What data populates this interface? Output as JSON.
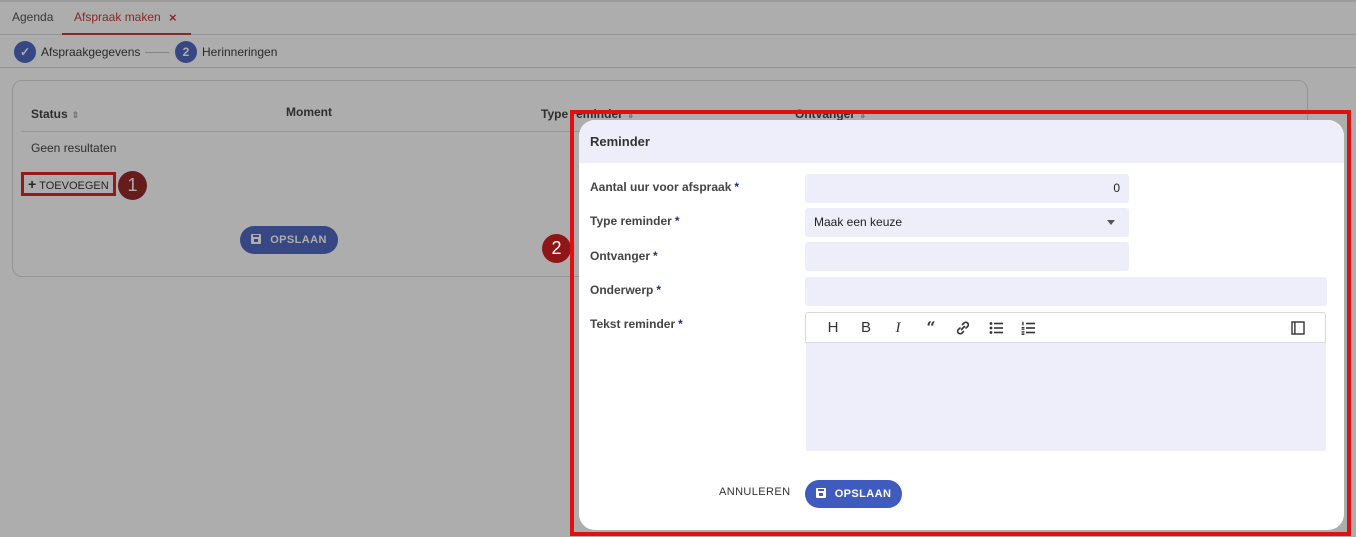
{
  "tabs": [
    {
      "label": "Agenda"
    },
    {
      "label": "Afspraak maken"
    }
  ],
  "tab_close_glyph": "×",
  "stepper": {
    "steps": [
      {
        "marker": "✓",
        "label": "Afspraakgegevens"
      },
      {
        "marker": "2",
        "label": "Herinneringen"
      }
    ]
  },
  "table": {
    "columns": [
      "Status",
      "Moment",
      "Type reminder",
      "Ontvanger"
    ],
    "empty_text": "Geen resultaten",
    "add_label": "TOEVOEGEN",
    "save_label": "OPSLAAN"
  },
  "badges": [
    "1",
    "2"
  ],
  "modal": {
    "title": "Reminder",
    "fields": {
      "hours": {
        "label": "Aantal uur voor afspraak",
        "value": "0"
      },
      "type": {
        "label": "Type reminder",
        "value": "Maak een keuze"
      },
      "recipient": {
        "label": "Ontvanger",
        "value": ""
      },
      "subject": {
        "label": "Onderwerp",
        "value": ""
      },
      "text": {
        "label": "Tekst reminder",
        "value": ""
      }
    },
    "required_marker": "*",
    "toolbar": [
      {
        "icon": "heading-icon",
        "glyph": "H"
      },
      {
        "icon": "bold-icon",
        "glyph": "B"
      },
      {
        "icon": "italic-icon",
        "glyph": "I"
      },
      {
        "icon": "quote-icon",
        "glyph": "“"
      },
      {
        "icon": "link-icon"
      },
      {
        "icon": "bullet-list-icon"
      },
      {
        "icon": "numbered-list-icon"
      },
      {
        "icon": "side-by-side-icon"
      }
    ],
    "cancel_label": "ANNULEREN",
    "save_label": "OPSLAAN"
  },
  "colors": {
    "accent": "#3f5bbd",
    "active_tab": "#c62828",
    "highlight": "#e01010",
    "badge": "#8e1616",
    "field_bg": "#eeeefa"
  }
}
